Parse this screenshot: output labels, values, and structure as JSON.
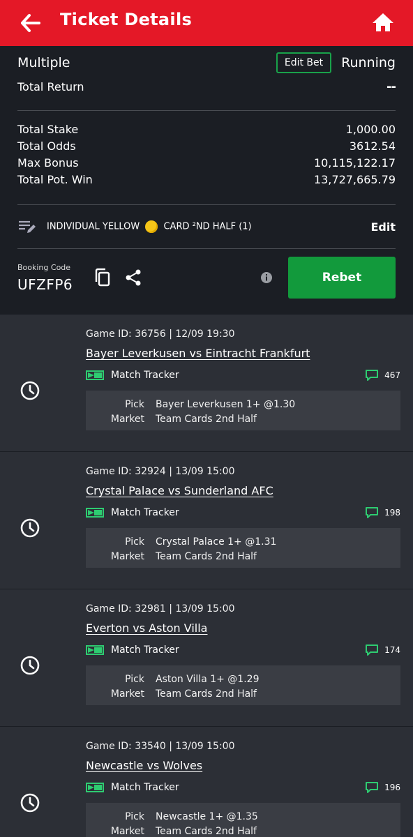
{
  "header": {
    "title": "Ticket Details"
  },
  "summary": {
    "bet_type": "Multiple",
    "edit_bet_label": "Edit Bet",
    "status": "Running",
    "total_return_label": "Total Return",
    "total_return_value": "--",
    "stats": [
      {
        "label": "Total Stake",
        "value": "1,000.00"
      },
      {
        "label": "Total Odds",
        "value": "3612.54"
      },
      {
        "label": "Max Bonus",
        "value": "10,115,122.17"
      },
      {
        "label": "Total Pot. Win",
        "value": "13,727,665.79"
      }
    ]
  },
  "promo": {
    "text_before": "INDIVIDUAL YELLOW",
    "text_after": "CARD ²ND HALF (1)",
    "edit_label": "Edit"
  },
  "booking": {
    "label": "Booking Code",
    "code": "UFZFP6",
    "rebet_label": "Rebet"
  },
  "games": [
    {
      "game_id": "Game ID: 36756 | 12/09 19:30",
      "teams": "Bayer Leverkusen vs Eintracht Frankfurt",
      "tracker_label": "Match Tracker",
      "comments": "467",
      "pick_label": "Pick",
      "pick": "Bayer Leverkusen 1+ @1.30",
      "market_label": "Market",
      "market": "Team Cards 2nd Half"
    },
    {
      "game_id": "Game ID: 32924 | 13/09 15:00",
      "teams": "Crystal Palace vs Sunderland AFC",
      "tracker_label": "Match Tracker",
      "comments": "198",
      "pick_label": "Pick",
      "pick": "Crystal Palace 1+ @1.31",
      "market_label": "Market",
      "market": "Team Cards 2nd Half"
    },
    {
      "game_id": "Game ID: 32981 | 13/09 15:00",
      "teams": "Everton vs Aston Villa",
      "tracker_label": "Match Tracker",
      "comments": "174",
      "pick_label": "Pick",
      "pick": "Aston Villa 1+ @1.29",
      "market_label": "Market",
      "market": "Team Cards 2nd Half"
    },
    {
      "game_id": "Game ID: 33540 | 13/09 15:00",
      "teams": "Newcastle vs Wolves",
      "tracker_label": "Match Tracker",
      "comments": "196",
      "pick_label": "Pick",
      "pick": "Newcastle 1+ @1.35",
      "market_label": "Market",
      "market": "Team Cards 2nd Half"
    }
  ],
  "icons": {
    "back": "arrow-left-icon",
    "home": "home-icon",
    "promo": "edit-list-icon",
    "copy": "copy-icon",
    "share": "share-icon",
    "info": "info-icon",
    "clock": "clock-icon",
    "tracker": "match-tracker-icon",
    "comment": "comment-icon"
  },
  "colors": {
    "header": "#e41827",
    "background": "#1b1e24",
    "card": "#2c2f36",
    "accent_green": "#129a3c",
    "tracker_green": "#2ecc71",
    "coin": "#f5c518"
  }
}
